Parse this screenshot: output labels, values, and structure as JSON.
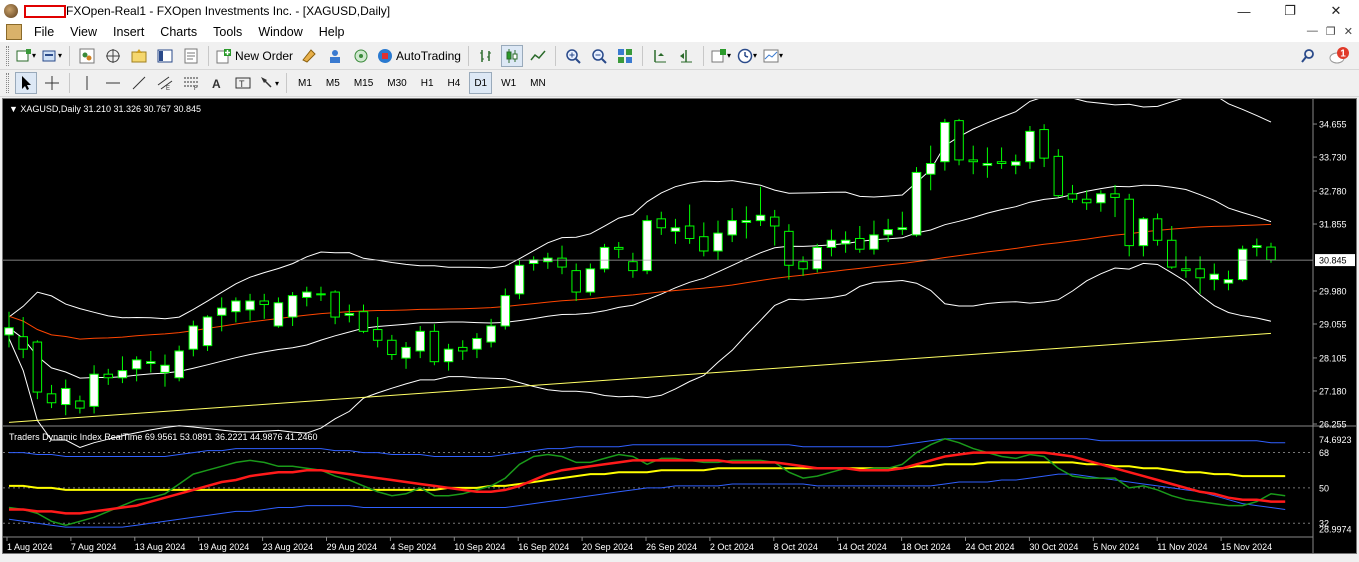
{
  "window": {
    "title": "FXOpen-Real1 - FXOpen Investments Inc. - [XAGUSD,Daily]",
    "minimize": "—",
    "restore": "❐",
    "close": "✕"
  },
  "menu": [
    "File",
    "View",
    "Insert",
    "Charts",
    "Tools",
    "Window",
    "Help"
  ],
  "toolbar": {
    "new_order": "New Order",
    "auto_trading": "AutoTrading",
    "notification_count": "1"
  },
  "timeframes": [
    "M1",
    "M5",
    "M15",
    "M30",
    "H1",
    "H4",
    "D1",
    "W1",
    "MN"
  ],
  "active_timeframe": "D1",
  "chart": {
    "header": "XAGUSD,Daily  31.210 31.326 30.767 30.845",
    "indicator_header": "Traders Dynamic Index RealTime 69.9561 53.0891 36.2221 44.9876 41.2460",
    "current_price": "30.845",
    "price_ticks": [
      "34.655",
      "33.730",
      "32.780",
      "31.855",
      "30.845",
      "29.980",
      "29.055",
      "28.105",
      "27.180",
      "26.255"
    ],
    "indicator_ticks": [
      "74.6923",
      "68",
      "50",
      "32",
      "28.9974"
    ],
    "date_ticks": [
      "1 Aug 2024",
      "7 Aug 2024",
      "13 Aug 2024",
      "19 Aug 2024",
      "23 Aug 2024",
      "29 Aug 2024",
      "4 Sep 2024",
      "10 Sep 2024",
      "16 Sep 2024",
      "20 Sep 2024",
      "26 Sep 2024",
      "2 Oct 2024",
      "8 Oct 2024",
      "14 Oct 2024",
      "18 Oct 2024",
      "24 Oct 2024",
      "30 Oct 2024",
      "5 Nov 2024",
      "11 Nov 2024",
      "15 Nov 2024"
    ],
    "colors": {
      "background": "#000000",
      "bull_candle": "#ffffff",
      "bear_candle": "#000000",
      "wick": "#00ff00",
      "bands": "#ffffff",
      "ma_fast": "#ff4500",
      "ma_slow": "#ffff66",
      "tdi_green": "#1a9a1a",
      "tdi_red": "#ff1a1a",
      "tdi_yellow": "#ffff00",
      "tdi_blue": "#3060ff"
    },
    "candles": [
      [
        28.75,
        29.4,
        28.4,
        28.95
      ],
      [
        28.7,
        29.25,
        28.1,
        28.35
      ],
      [
        28.55,
        28.6,
        26.95,
        27.15
      ],
      [
        27.1,
        27.35,
        26.7,
        26.85
      ],
      [
        26.8,
        27.5,
        26.5,
        27.25
      ],
      [
        26.9,
        27.05,
        26.55,
        26.7
      ],
      [
        26.75,
        27.9,
        26.55,
        27.65
      ],
      [
        27.65,
        27.8,
        27.35,
        27.55
      ],
      [
        27.55,
        28.15,
        27.4,
        27.75
      ],
      [
        27.8,
        28.15,
        27.45,
        28.05
      ],
      [
        27.95,
        28.3,
        27.7,
        28.0
      ],
      [
        27.7,
        28.2,
        27.3,
        27.9
      ],
      [
        27.55,
        28.45,
        27.45,
        28.3
      ],
      [
        28.35,
        29.15,
        28.15,
        29.0
      ],
      [
        28.45,
        29.3,
        28.3,
        29.25
      ],
      [
        29.3,
        29.8,
        28.85,
        29.5
      ],
      [
        29.4,
        29.8,
        29.1,
        29.7
      ],
      [
        29.45,
        29.9,
        29.15,
        29.7
      ],
      [
        29.7,
        29.9,
        29.2,
        29.6
      ],
      [
        29.0,
        29.8,
        28.95,
        29.65
      ],
      [
        29.25,
        29.95,
        29.0,
        29.85
      ],
      [
        29.8,
        30.1,
        29.55,
        29.95
      ],
      [
        29.9,
        30.1,
        29.7,
        29.9
      ],
      [
        29.95,
        30.0,
        29.05,
        29.25
      ],
      [
        29.3,
        29.6,
        29.1,
        29.35
      ],
      [
        29.4,
        29.6,
        28.8,
        28.85
      ],
      [
        28.9,
        29.25,
        28.4,
        28.6
      ],
      [
        28.6,
        28.75,
        28.05,
        28.2
      ],
      [
        28.1,
        28.55,
        27.8,
        28.4
      ],
      [
        28.3,
        29.0,
        28.1,
        28.85
      ],
      [
        28.85,
        29.05,
        27.9,
        28.0
      ],
      [
        28.0,
        28.5,
        27.75,
        28.35
      ],
      [
        28.4,
        28.6,
        28.05,
        28.3
      ],
      [
        28.35,
        28.8,
        28.1,
        28.65
      ],
      [
        28.55,
        29.2,
        28.4,
        29.0
      ],
      [
        29.0,
        30.05,
        28.9,
        29.85
      ],
      [
        29.9,
        30.85,
        29.75,
        30.7
      ],
      [
        30.75,
        30.95,
        30.55,
        30.85
      ],
      [
        30.8,
        31.05,
        30.6,
        30.9
      ],
      [
        30.9,
        31.25,
        30.45,
        30.65
      ],
      [
        30.55,
        30.75,
        29.7,
        29.95
      ],
      [
        29.95,
        30.75,
        29.85,
        30.6
      ],
      [
        30.6,
        31.3,
        30.5,
        31.2
      ],
      [
        31.2,
        31.35,
        30.9,
        31.15
      ],
      [
        30.8,
        31.05,
        30.35,
        30.55
      ],
      [
        30.55,
        32.1,
        30.45,
        31.95
      ],
      [
        32.0,
        32.2,
        31.55,
        31.75
      ],
      [
        31.65,
        32.0,
        31.3,
        31.75
      ],
      [
        31.8,
        32.4,
        31.3,
        31.45
      ],
      [
        31.5,
        31.9,
        30.95,
        31.1
      ],
      [
        31.1,
        31.95,
        30.85,
        31.6
      ],
      [
        31.55,
        32.3,
        31.35,
        31.95
      ],
      [
        31.9,
        32.35,
        31.45,
        31.95
      ],
      [
        31.95,
        32.9,
        31.8,
        32.1
      ],
      [
        32.05,
        32.25,
        31.25,
        31.8
      ],
      [
        31.65,
        31.85,
        30.3,
        30.7
      ],
      [
        30.8,
        30.95,
        30.4,
        30.6
      ],
      [
        30.6,
        31.3,
        30.5,
        31.2
      ],
      [
        31.2,
        31.7,
        30.95,
        31.4
      ],
      [
        31.3,
        31.65,
        31.05,
        31.4
      ],
      [
        31.45,
        31.8,
        31.05,
        31.15
      ],
      [
        31.15,
        31.95,
        31.0,
        31.55
      ],
      [
        31.55,
        32.0,
        31.35,
        31.7
      ],
      [
        31.7,
        32.2,
        31.55,
        31.75
      ],
      [
        31.55,
        33.45,
        31.5,
        33.3
      ],
      [
        33.25,
        34.05,
        32.8,
        33.55
      ],
      [
        33.6,
        34.8,
        33.35,
        34.7
      ],
      [
        34.75,
        34.8,
        33.5,
        33.65
      ],
      [
        33.65,
        34.05,
        33.25,
        33.6
      ],
      [
        33.5,
        34.0,
        33.15,
        33.55
      ],
      [
        33.6,
        34.0,
        33.4,
        33.55
      ],
      [
        33.5,
        33.8,
        33.25,
        33.6
      ],
      [
        33.6,
        34.6,
        33.4,
        34.45
      ],
      [
        34.5,
        34.65,
        33.45,
        33.7
      ],
      [
        33.75,
        33.95,
        32.6,
        32.65
      ],
      [
        32.7,
        32.95,
        32.45,
        32.55
      ],
      [
        32.55,
        32.8,
        32.25,
        32.45
      ],
      [
        32.45,
        32.8,
        32.2,
        32.7
      ],
      [
        32.7,
        32.95,
        32.05,
        32.6
      ],
      [
        32.55,
        32.7,
        30.95,
        31.25
      ],
      [
        31.25,
        32.05,
        30.95,
        32.0
      ],
      [
        32.0,
        32.15,
        31.25,
        31.4
      ],
      [
        31.4,
        31.8,
        30.6,
        30.65
      ],
      [
        30.6,
        30.95,
        30.35,
        30.55
      ],
      [
        30.6,
        30.95,
        29.9,
        30.35
      ],
      [
        30.3,
        30.75,
        30.0,
        30.45
      ],
      [
        30.2,
        30.55,
        30.0,
        30.3
      ],
      [
        30.3,
        31.25,
        30.25,
        31.15
      ],
      [
        31.2,
        31.45,
        30.95,
        31.25
      ],
      [
        31.21,
        31.33,
        30.77,
        30.85
      ]
    ],
    "tdi": {
      "green": [
        40,
        39,
        37,
        33,
        31,
        33,
        35,
        38,
        41,
        44,
        45,
        47,
        52,
        57,
        59,
        61,
        63,
        64,
        63,
        61,
        61,
        60,
        59,
        56,
        54,
        51,
        48,
        46,
        47,
        50,
        46,
        46,
        47,
        49,
        51,
        55,
        62,
        66,
        67,
        66,
        63,
        63,
        65,
        67,
        66,
        62,
        65,
        65,
        64,
        63,
        63,
        64,
        64,
        64,
        63,
        58,
        55,
        56,
        58,
        60,
        59,
        60,
        60,
        62,
        68,
        72,
        75,
        73,
        70,
        68,
        66,
        65,
        67,
        66,
        60,
        56,
        55,
        55,
        55,
        50,
        51,
        49,
        46,
        44,
        43,
        42,
        41,
        41,
        43,
        47,
        46
      ],
      "red": [
        39,
        39,
        38,
        38,
        37,
        37,
        38,
        39,
        40,
        41,
        43,
        45,
        47,
        49,
        51,
        53,
        54,
        56,
        57,
        58,
        58,
        59,
        59,
        58,
        57,
        56,
        55,
        54,
        53,
        52,
        51,
        50,
        49,
        48,
        48,
        49,
        51,
        54,
        57,
        59,
        60,
        61,
        62,
        63,
        64,
        64,
        64,
        64,
        64,
        64,
        64,
        63,
        63,
        63,
        63,
        62,
        61,
        60,
        60,
        60,
        59,
        59,
        59,
        60,
        62,
        64,
        66,
        67,
        68,
        68,
        68,
        68,
        68,
        68,
        67,
        66,
        64,
        62,
        60,
        58,
        56,
        54,
        52,
        50,
        48,
        47,
        45,
        44,
        44,
        43,
        43
      ],
      "yellow": [
        51,
        51,
        50,
        50,
        49,
        49,
        49,
        49,
        49,
        49,
        49,
        49,
        49,
        49,
        49,
        49,
        49,
        49,
        49,
        49,
        49,
        49,
        49,
        49,
        49,
        49,
        49,
        49,
        49,
        49,
        49,
        50,
        50,
        50,
        51,
        51,
        52,
        53,
        54,
        55,
        56,
        57,
        57,
        58,
        58,
        58,
        59,
        59,
        59,
        59,
        60,
        60,
        60,
        60,
        60,
        60,
        60,
        60,
        60,
        60,
        60,
        60,
        60,
        60,
        61,
        61,
        62,
        62,
        62,
        63,
        63,
        63,
        63,
        63,
        63,
        63,
        62,
        62,
        61,
        61,
        60,
        60,
        59,
        58,
        58,
        57,
        57,
        56,
        56,
        56,
        56
      ],
      "upper": [
        68,
        68,
        67,
        67,
        66,
        66,
        66,
        66,
        66,
        66,
        66,
        66,
        67,
        68,
        69,
        69,
        70,
        70,
        70,
        70,
        70,
        70,
        70,
        69,
        69,
        68,
        68,
        67,
        67,
        67,
        66,
        66,
        66,
        66,
        66,
        67,
        68,
        69,
        70,
        70,
        71,
        71,
        71,
        71,
        72,
        72,
        72,
        72,
        72,
        72,
        72,
        72,
        72,
        72,
        72,
        72,
        71,
        71,
        71,
        71,
        71,
        71,
        71,
        72,
        73,
        74,
        75,
        75,
        75,
        75,
        75,
        75,
        75,
        75,
        75,
        75,
        75,
        74,
        74,
        74,
        74,
        74,
        74,
        74,
        74,
        74,
        74,
        74,
        74,
        73,
        73
      ],
      "lower": [
        34,
        33,
        32,
        31,
        30,
        30,
        30,
        30,
        30,
        31,
        32,
        33,
        34,
        35,
        36,
        37,
        38,
        38,
        39,
        40,
        40,
        41,
        41,
        41,
        41,
        40,
        40,
        40,
        40,
        40,
        40,
        40,
        40,
        40,
        40,
        40,
        41,
        42,
        43,
        44,
        45,
        46,
        47,
        48,
        49,
        50,
        50,
        51,
        51,
        51,
        51,
        52,
        52,
        52,
        52,
        52,
        52,
        51,
        51,
        51,
        51,
        51,
        51,
        51,
        51,
        51,
        52,
        53,
        53,
        53,
        54,
        54,
        55,
        56,
        57,
        57,
        56,
        55,
        54,
        53,
        52,
        51,
        50,
        49,
        48,
        46,
        44,
        42,
        41,
        40,
        39
      ]
    }
  }
}
